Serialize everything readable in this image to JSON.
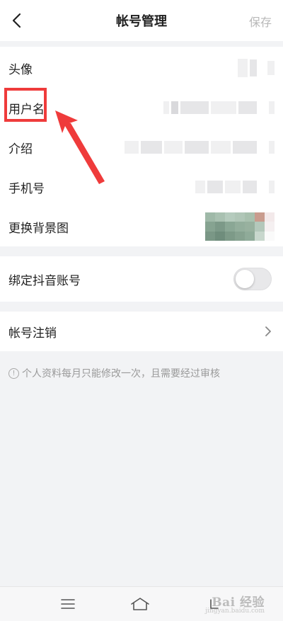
{
  "header": {
    "title": "帐号管理",
    "save_label": "保存"
  },
  "profile": {
    "rows": [
      {
        "label": "头像"
      },
      {
        "label": "用户名"
      },
      {
        "label": "介绍"
      },
      {
        "label": "手机号"
      },
      {
        "label": "更换背景图"
      }
    ]
  },
  "binding": {
    "label": "绑定抖音账号",
    "enabled": false
  },
  "account": {
    "cancel_label": "帐号注销"
  },
  "notice": {
    "icon": "!",
    "text": "个人资料每月只能修改一次，且需要经过审核"
  },
  "annotation": {
    "color": "#ef3b3b"
  },
  "watermark": {
    "text": "Bai 经验",
    "sub": "jingyan.baidu.com"
  },
  "colors": {
    "background": "#f2f3f5",
    "card": "#ffffff",
    "muted": "#9a9a9a"
  }
}
